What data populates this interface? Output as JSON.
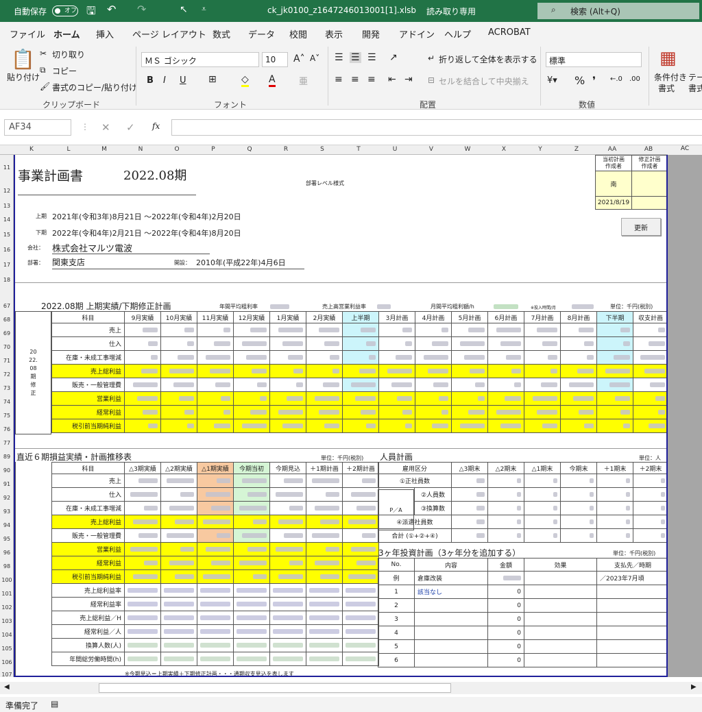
{
  "title": {
    "autosave": "自動保存",
    "toggle": "オフ",
    "filename": "ck_jk0100_z1647246013001[1].xlsb",
    "mode": "読み取り専用",
    "search": "検索 (Alt+Q)"
  },
  "tabs": [
    "ファイル",
    "ホーム",
    "挿入",
    "ページ レイアウト",
    "数式",
    "データ",
    "校閲",
    "表示",
    "開発",
    "アドイン",
    "ヘルプ",
    "ACROBAT"
  ],
  "ribbon": {
    "paste": "貼り付け",
    "cut": "切り取り",
    "copy": "コピー",
    "format_painter": "書式のコピー/貼り付け",
    "clipboard": "クリップボード",
    "font_name": "ＭＳ ゴシック",
    "font_size": "10",
    "font_group": "フォント",
    "wrap": "折り返して全体を表示する",
    "merge": "セルを結合して中央揃え",
    "align_group": "配置",
    "number_format": "標準",
    "number_group": "数値",
    "cond_format": "条件付き",
    "cond_format2": "書式",
    "table_fmt": "テー",
    "table_fmt2": "書式"
  },
  "formula": {
    "cell": "AF34",
    "value": ""
  },
  "columns": [
    "K",
    "L",
    "M",
    "N",
    "O",
    "P",
    "Q",
    "R",
    "S",
    "T",
    "U",
    "V",
    "W",
    "X",
    "Y",
    "Z",
    "AA",
    "AB",
    "AC"
  ],
  "rows": [
    "11",
    "12",
    "13",
    "14",
    "15",
    "16",
    "17",
    "18",
    "67",
    "68",
    "69",
    "70",
    "71",
    "72",
    "73",
    "74",
    "75",
    "76",
    "77",
    "89",
    "90",
    "91",
    "92",
    "93",
    "94",
    "95",
    "96",
    "98",
    "100",
    "101",
    "102",
    "103",
    "104",
    "105",
    "106",
    "107"
  ],
  "header": {
    "title": "事業計画書",
    "period": "2022.08期",
    "dept_format": "部署レベル様式",
    "plan_creator": "当初計画\n作成者",
    "rev_creator": "修正計画\n作成者",
    "creator_name": "南",
    "date": "2021/8/19",
    "update": "更新"
  },
  "info": {
    "first_label": "上期",
    "first": "2021年(令和3年)8月21日 ～2022年(令和4年)2月20日",
    "second_label": "下期",
    "second": "2022年(令和4年)2月21日 ～2022年(令和4年)8月20日",
    "company_label": "会社：",
    "company": "株式会社マルツ電波",
    "dept_label": "部署：",
    "dept": "関東支店",
    "open_label": "開設：",
    "open": "2010年(平成22年)4月6日"
  },
  "sec1": {
    "title": "2022.08期 上期実績/下期修正計画",
    "avg_gross": "年間平均粗利率",
    "sales_op": "売上高営業利益率",
    "monthly": "月間平均粗利額/h",
    "note": "※投入時間/月",
    "unit": "単位：千円(税別)",
    "vert": "2022.08期修正",
    "headers": [
      "科目",
      "9月実績",
      "10月実績",
      "11月実績",
      "12月実績",
      "1月実績",
      "2月実績",
      "上半期",
      "3月計画",
      "4月計画",
      "5月計画",
      "6月計画",
      "7月計画",
      "8月計画",
      "下半期",
      "収支計画"
    ],
    "items": [
      "売上",
      "仕入",
      "在庫・未成工事増減",
      "売上総利益",
      "販売・一般管理費",
      "営業利益",
      "経常利益",
      "税引前当期純利益"
    ]
  },
  "sec2": {
    "title": "直近６期損益実績・計画推移表",
    "unit": "単位：千円(税別)",
    "headers": [
      "科目",
      "△3期実績",
      "△2期実績",
      "△1期実績",
      "今期当初",
      "今期見込",
      "＋1期計画",
      "＋2期計画"
    ],
    "items": [
      "売上",
      "仕入",
      "在庫・未成工事増減",
      "売上総利益",
      "販売・一般管理費",
      "営業利益",
      "経常利益",
      "税引前当期純利益",
      "売上総利益率",
      "経常利益率",
      "売上総利益／H",
      "経常利益／人",
      "換算人数(人)",
      "年間総労働時間(h)"
    ],
    "note": "※今期見込＝上期実績＋下期修正計画・・・通期収支見込を表します"
  },
  "sec3": {
    "title": "人員計画",
    "unit": "単位：人",
    "headers": [
      "雇用区分",
      "△3期末",
      "△2期末",
      "△1期末",
      "今期末",
      "＋1期末",
      "＋2期末"
    ],
    "rows": [
      "①正社員数",
      "②人員数",
      "③換算数",
      "④派遣社員数",
      "合計 (①+②+④)"
    ],
    "pa": "P／A"
  },
  "sec4": {
    "title": "3ヶ年投資計画（3ヶ年分を追加する）",
    "unit": "単位：千円(税別)",
    "headers": [
      "No.",
      "内容",
      "金額",
      "効果",
      "支払先／時期"
    ],
    "example_label": "例",
    "example_content": "倉庫改装",
    "example_pay": "／2023年7月頃",
    "nos": [
      "1",
      "2",
      "3",
      "4",
      "5",
      "6"
    ],
    "first_content": "該当なし",
    "zero": "0"
  },
  "status": "準備完了"
}
